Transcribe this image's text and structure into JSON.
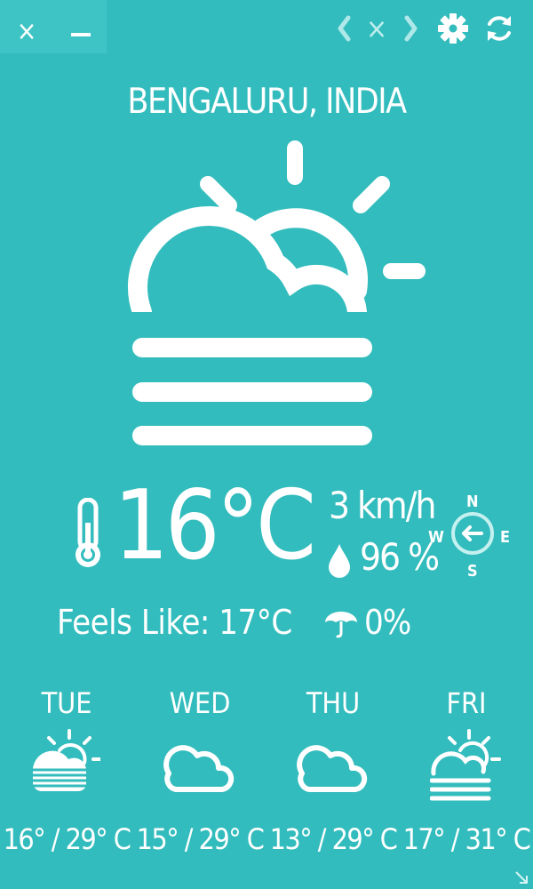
{
  "toolbar": {
    "close_glyph": "×",
    "location_close_glyph": "×"
  },
  "location": {
    "city": "BENGALURU, INDIA"
  },
  "current": {
    "condition_icon": "sun-behind-cloud-fog-icon",
    "temperature": "16°C",
    "feels_like": "Feels Like: 17°C",
    "wind": "3 km/h",
    "humidity": "96 %",
    "precipitation": "0%",
    "wind_direction": "W",
    "compass": {
      "n": "N",
      "e": "E",
      "s": "S",
      "w": "W"
    }
  },
  "forecast": [
    {
      "day": "TUE",
      "icon": "sun-behind-cloud-fog-icon",
      "range": "16° / 29° C"
    },
    {
      "day": "WED",
      "icon": "cloud-icon",
      "range": "15° / 29° C"
    },
    {
      "day": "THU",
      "icon": "cloud-icon",
      "range": "13° / 29° C"
    },
    {
      "day": "FRI",
      "icon": "sun-behind-cloud-fog-icon",
      "range": "17° / 31° C"
    }
  ],
  "colors": {
    "background": "#33bcbd",
    "foreground": "#ffffff"
  }
}
